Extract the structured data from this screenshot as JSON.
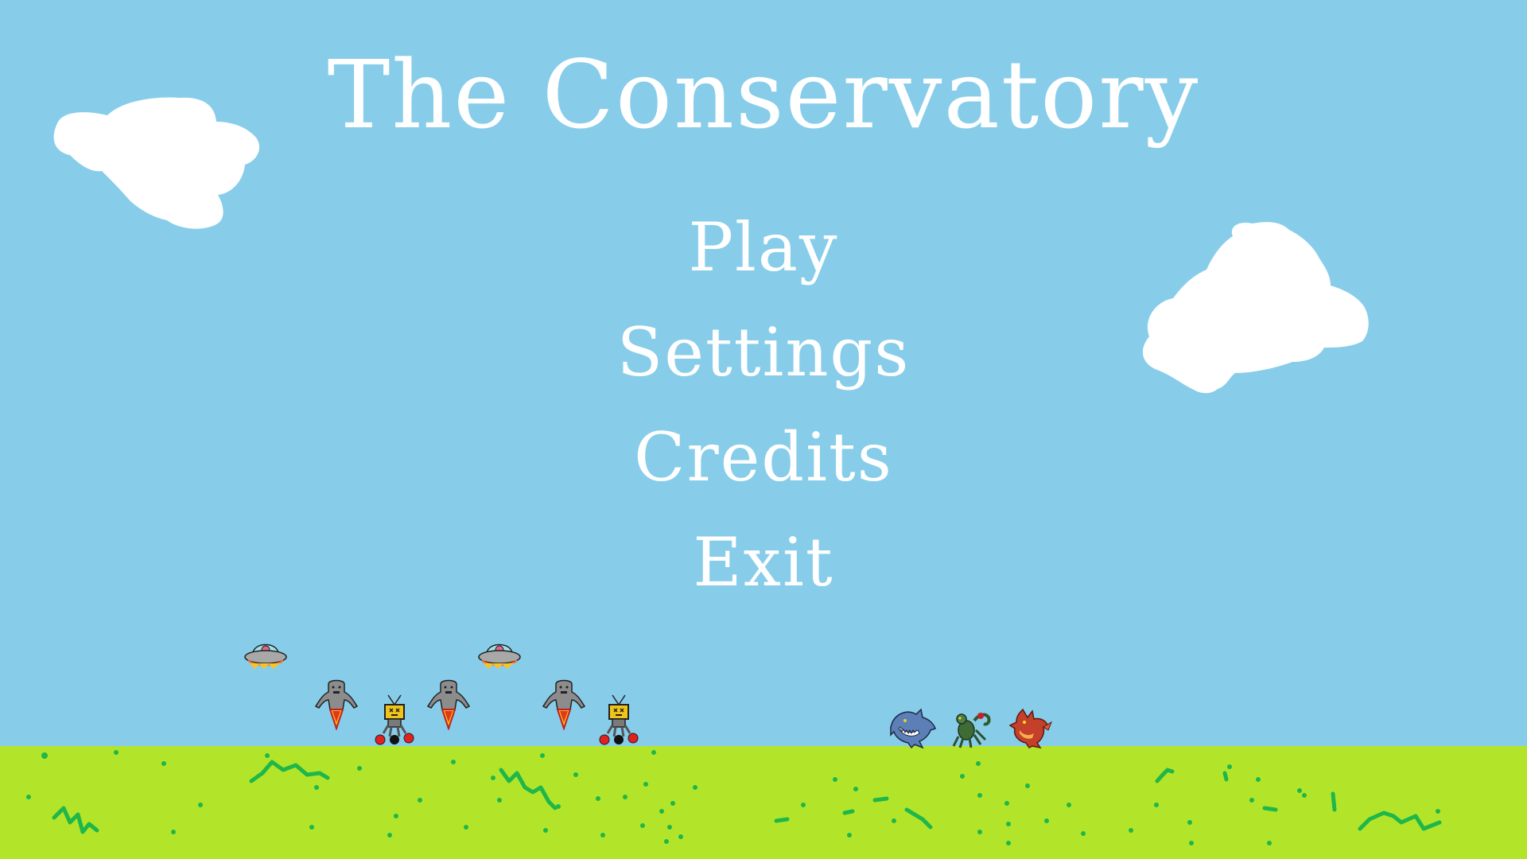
{
  "game": {
    "title": "The Conservatory"
  },
  "menu": {
    "items": [
      {
        "id": "play",
        "label": "Play"
      },
      {
        "id": "settings",
        "label": "Settings"
      },
      {
        "id": "credits",
        "label": "Credits"
      },
      {
        "id": "exit",
        "label": "Exit"
      }
    ]
  },
  "colors": {
    "sky": "#87cdea",
    "grass": "#b2e52a",
    "grass_marks": "#1fb64a",
    "text": "#ffffff",
    "cloud": "#ffffff"
  },
  "sprites": {
    "enemies": [
      "ufo-icon",
      "ufo-icon",
      "jetpack-ghoul-icon",
      "jetpack-ghoul-icon",
      "jetpack-ghoul-icon",
      "tv-robot-icon",
      "tv-robot-icon"
    ],
    "heroes": [
      "shark-creature-icon",
      "scorpion-creature-icon",
      "dragon-creature-icon"
    ]
  }
}
